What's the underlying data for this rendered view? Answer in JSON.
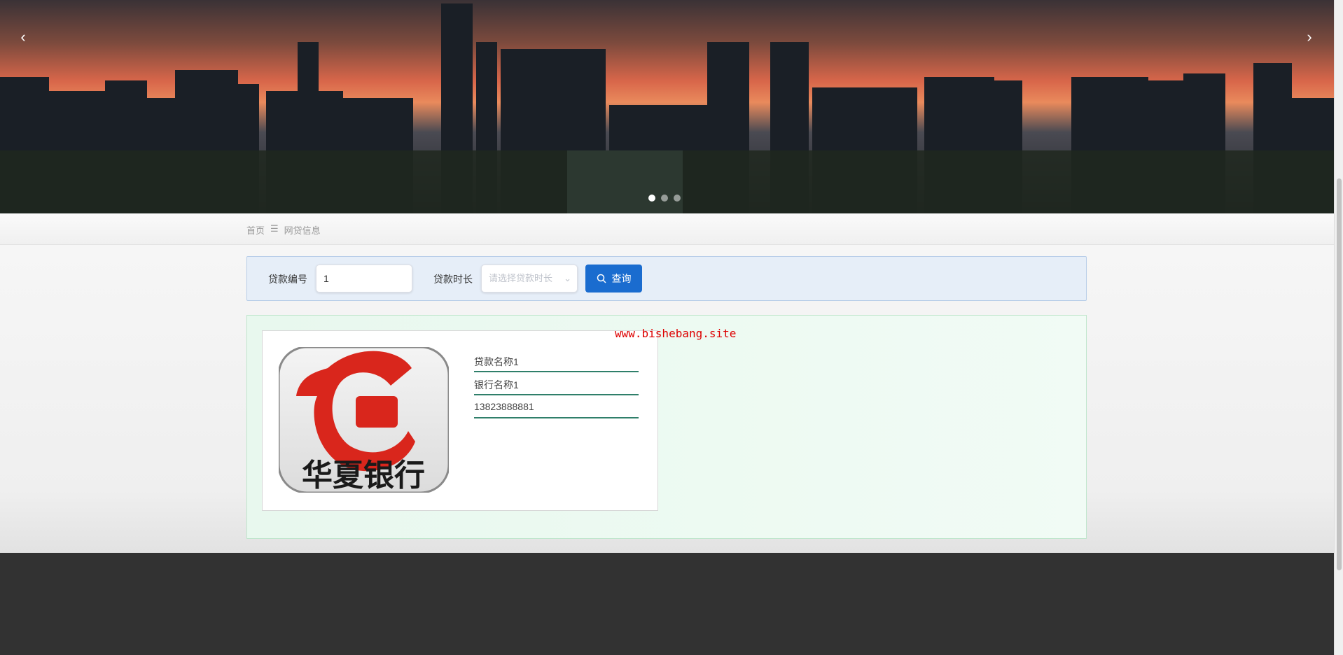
{
  "carousel": {
    "prev": "‹",
    "next": "›",
    "slides": 3,
    "active": 0
  },
  "breadcrumb": {
    "home": "首页",
    "separator": "☰",
    "current": "网贷信息"
  },
  "search": {
    "loan_id_label": "贷款编号",
    "loan_id_value": "1",
    "duration_label": "贷款时长",
    "duration_placeholder": "请选择贷款时长",
    "query_button": "查询"
  },
  "results": [
    {
      "logo_text": "华夏银行",
      "loan_name": "贷款名称1",
      "bank_name": "银行名称1",
      "phone": "13823888881"
    }
  ],
  "watermark": "www.bishebang.site"
}
